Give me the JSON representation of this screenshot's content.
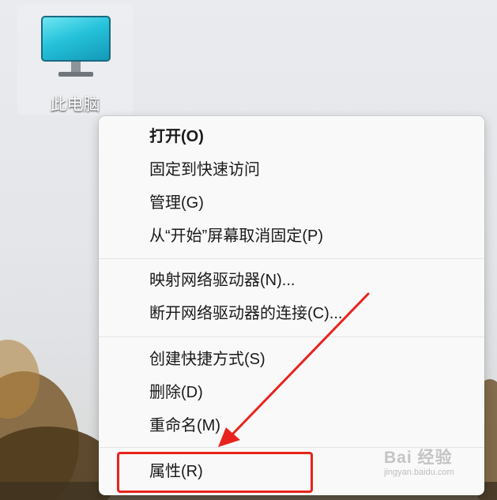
{
  "desktop": {
    "icon_label": "此电脑"
  },
  "context_menu": {
    "groups": [
      [
        "打开(O)",
        "固定到快速访问",
        "管理(G)",
        "从“开始”屏幕取消固定(P)"
      ],
      [
        "映射网络驱动器(N)...",
        "断开网络驱动器的连接(C)..."
      ],
      [
        "创建快捷方式(S)",
        "删除(D)",
        "重命名(M)"
      ],
      [
        "属性(R)"
      ]
    ],
    "items": {
      "open": "打开(O)",
      "pin_quick_access": "固定到快速访问",
      "manage": "管理(G)",
      "unpin_start": "从“开始”屏幕取消固定(P)",
      "map_drive": "映射网络驱动器(N)...",
      "disconnect_drive": "断开网络驱动器的连接(C)...",
      "create_shortcut": "创建快捷方式(S)",
      "delete": "删除(D)",
      "rename": "重命名(M)",
      "properties": "属性(R)"
    }
  },
  "annotation": {
    "highlight_color": "#e8231d",
    "target": "属性(R)"
  },
  "watermark": {
    "brand": "Bai 经验",
    "url": "jingyan.baidu.com"
  }
}
